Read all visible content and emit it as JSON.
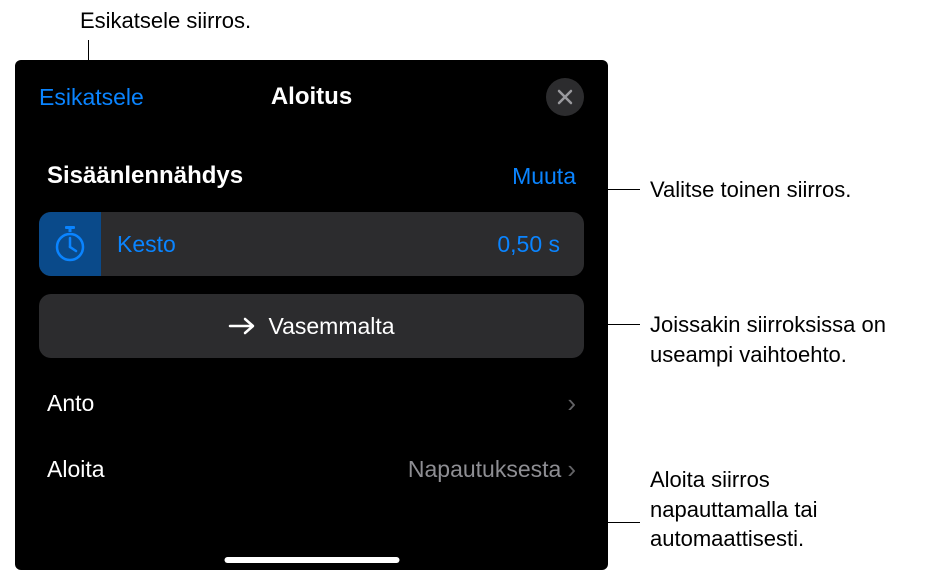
{
  "callouts": {
    "top": "Esikatsele siirros.",
    "change": "Valitse toinen siirros.",
    "direction": "Joissakin siirroksissa on useampi vaihtoehto.",
    "start": "Aloita siirros napauttamalla tai automaattisesti."
  },
  "panel": {
    "preview": "Esikatsele",
    "title": "Aloitus",
    "section_title": "Sisäänlennähdys",
    "change": "Muuta",
    "duration_label": "Kesto",
    "duration_value": "0,50 s",
    "direction": "Vasemmalta",
    "delivery_label": "Anto",
    "start_label": "Aloita",
    "start_value": "Napautuksesta"
  }
}
